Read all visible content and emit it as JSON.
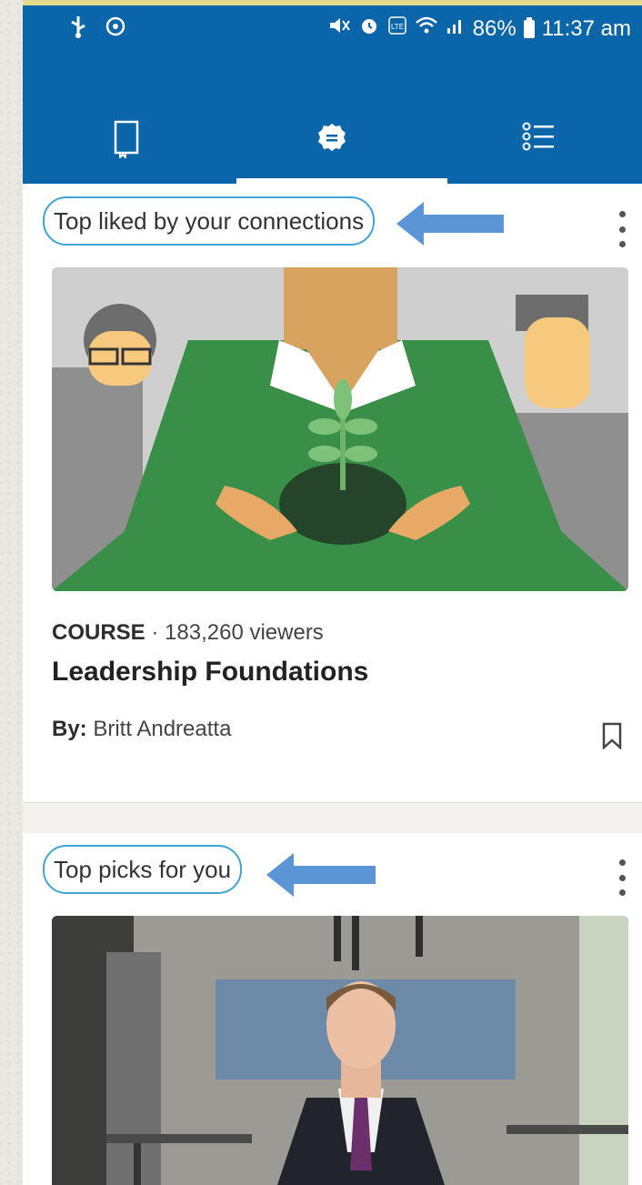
{
  "status_bar": {
    "left_icons": [
      "usb-icon",
      "sync-icon"
    ],
    "right_icons": [
      "mute-icon",
      "alarm-icon",
      "volte-icon",
      "wifi-icon",
      "signal-icon"
    ],
    "battery": "86%",
    "time": "11:37 am"
  },
  "tabs": [
    {
      "name": "library",
      "icon": "book-icon",
      "selected": false
    },
    {
      "name": "home",
      "icon": "badge-icon",
      "selected": true
    },
    {
      "name": "topics",
      "icon": "list-icon",
      "selected": false
    }
  ],
  "colors": {
    "brand": "#0a66a8",
    "annotation": "#3fa4d6",
    "arrow": "#5b95d6"
  },
  "feed": [
    {
      "section_title": "Top liked by your connections",
      "course": {
        "type": "COURSE",
        "separator": "·",
        "viewers": "183,260 viewers",
        "title": "Leadership Foundations",
        "author_label": "By:",
        "author": "Britt Andreatta"
      }
    },
    {
      "section_title": "Top picks for you"
    }
  ]
}
